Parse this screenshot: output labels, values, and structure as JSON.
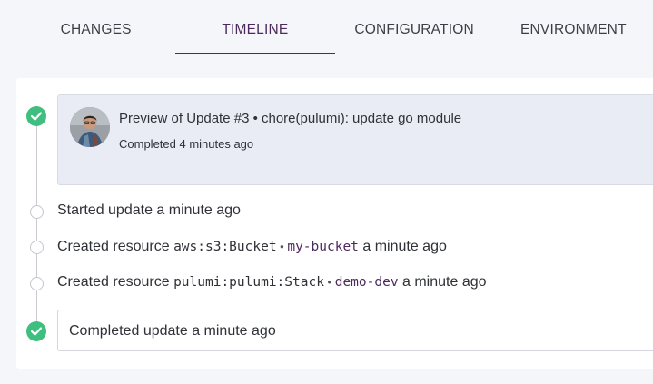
{
  "tabs": [
    {
      "label": "CHANGES"
    },
    {
      "label": "TIMELINE"
    },
    {
      "label": "CONFIGURATION"
    },
    {
      "label": "ENVIRONMENT"
    }
  ],
  "active_tab": "TIMELINE",
  "timeline": {
    "preview": {
      "title": "Preview of Update #3 • chore(pulumi): update go module",
      "status": "Completed 4 minutes ago"
    },
    "events": [
      {
        "text": "Started update a minute ago"
      },
      {
        "prefix": "Created resource ",
        "type": "aws:s3:Bucket",
        "sep": " • ",
        "name": "my-bucket",
        "time": " a minute ago"
      },
      {
        "prefix": "Created resource ",
        "type": "pulumi:pulumi:Stack",
        "sep": " • ",
        "name": "demo-dev",
        "time": " a minute ago"
      }
    ],
    "final": {
      "text": "Completed update a minute ago"
    }
  },
  "colors": {
    "accent": "#4d2a5c",
    "success": "#3fbf7f"
  },
  "icons": {
    "success": "check-circle-icon",
    "pending": "empty-circle-icon"
  }
}
